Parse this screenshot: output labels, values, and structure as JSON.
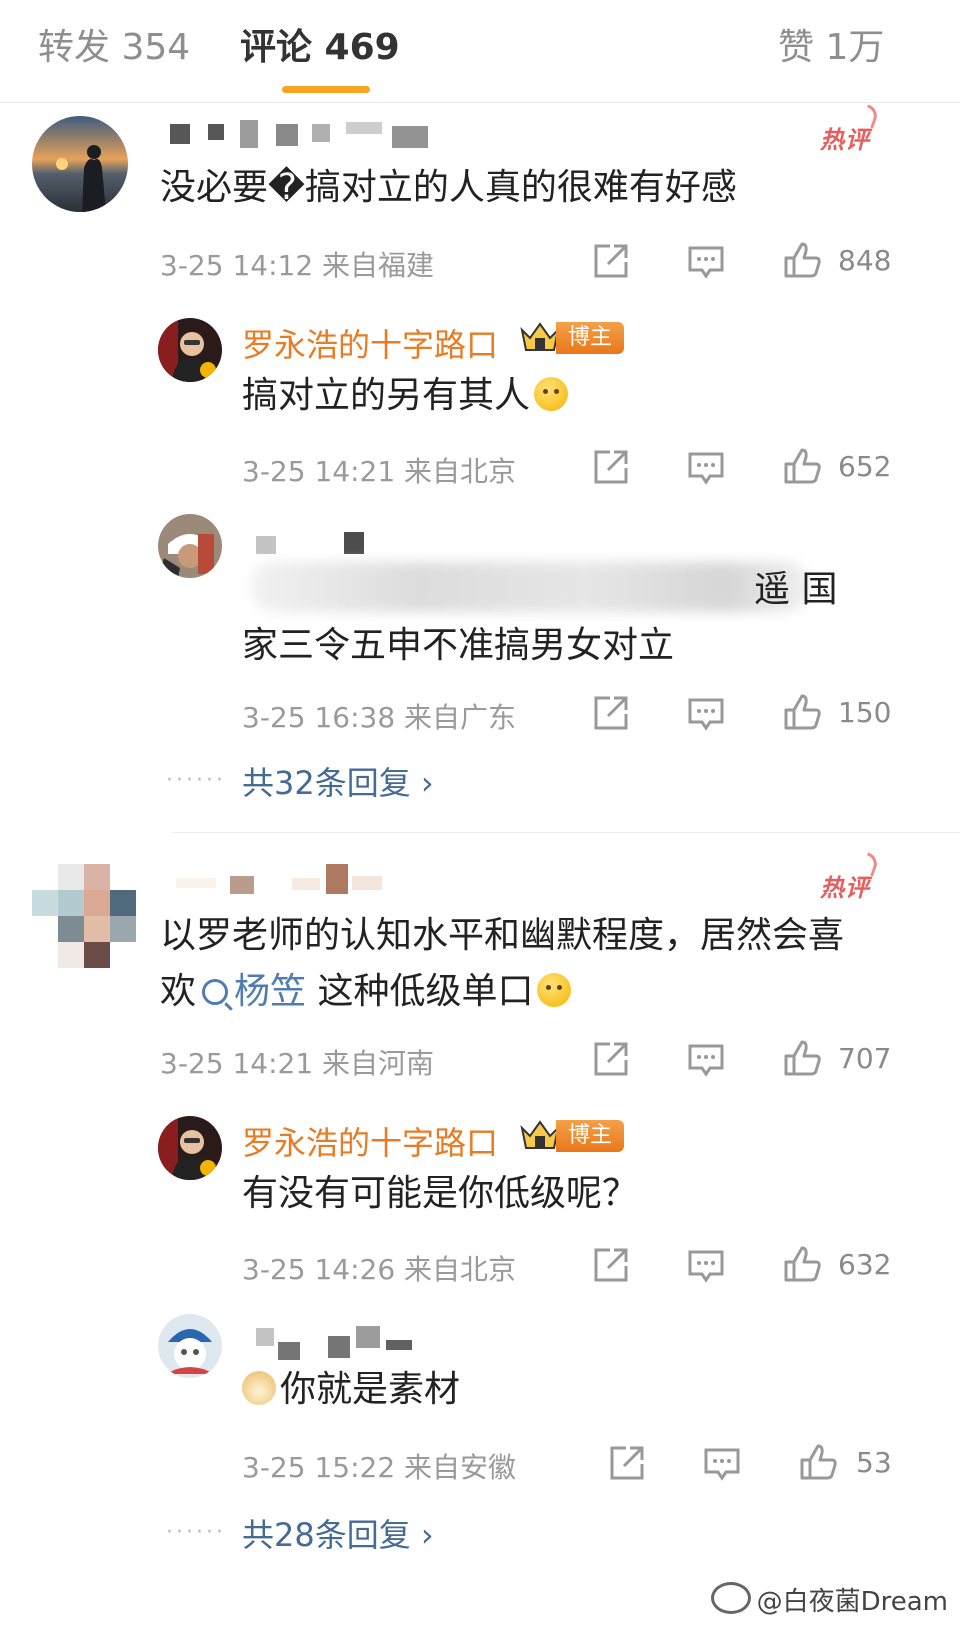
{
  "tabs": {
    "repost": "转发 354",
    "comments": "评论 469",
    "likes": "赞 1万"
  },
  "comments": [
    {
      "badge": "热评",
      "text": "没必要�搞对立的人真的很难有好感",
      "meta": "3-25 14:12 来自福建",
      "likes": "848",
      "replies": [
        {
          "name": "罗永浩的十字路口",
          "tag": "博主",
          "text": "搞对立的另有其人",
          "meta": "3-25 14:21 来自北京",
          "likes": "652"
        },
        {
          "text_line1": "遥 国",
          "text_line2": "家三令五申不准搞男女对立",
          "meta": "3-25 16:38 来自广东",
          "likes": "150"
        }
      ],
      "more": "共32条回复 ›"
    },
    {
      "badge": "热评",
      "text_line1": "以罗老师的认知水平和幽默程度，居然会喜",
      "text_line2_prefix": "欢",
      "text_line2_link": "杨笠",
      "text_line2_suffix": " 这种低级单口",
      "meta": "3-25 14:21 来自河南",
      "likes": "707",
      "replies": [
        {
          "name": "罗永浩的十字路口",
          "tag": "博主",
          "text": "有没有可能是你低级呢？",
          "meta": "3-25 14:26 来自北京",
          "likes": "632"
        },
        {
          "text": "你就是素材",
          "meta": "3-25 15:22 来自安徽",
          "likes": "53"
        }
      ],
      "more": "共28条回复 ›"
    }
  ],
  "more_dots": "······",
  "watermark": "@白夜菌Dream",
  "colors": {
    "accent": "#f6a623",
    "hot": "#e85d5d",
    "blogger": "#e87c24",
    "link": "#456b95"
  }
}
